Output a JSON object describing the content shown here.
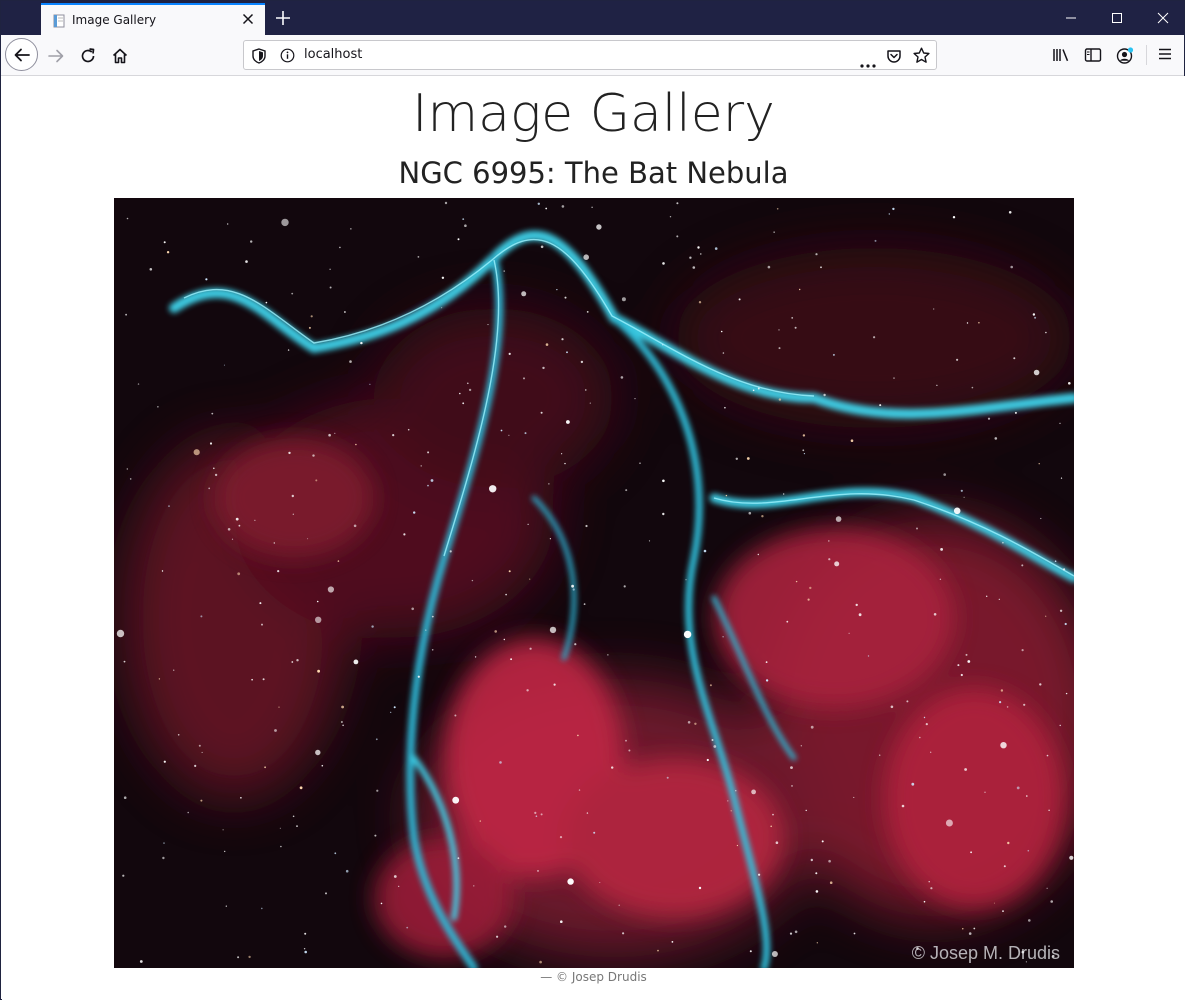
{
  "browser": {
    "tab_title": "Image Gallery",
    "url": "localhost"
  },
  "page": {
    "heading": "Image Gallery",
    "subheading": "NGC 6995: The Bat Nebula",
    "image_watermark": "© Josep M. Drudis",
    "caption": "— © Josep Drudis"
  },
  "icons": {
    "favicon": "page-icon",
    "tab_close": "close-icon",
    "new_tab": "plus-icon",
    "minimize": "minimize-icon",
    "maximize": "maximize-icon",
    "close_window": "close-icon",
    "back": "arrow-left-icon",
    "forward": "arrow-right-icon",
    "reload": "reload-icon",
    "home": "home-icon",
    "tracking_protection": "shield-icon",
    "site_info": "info-icon",
    "page_actions": "more-icon",
    "pocket": "pocket-icon",
    "bookmark": "star-icon",
    "library": "library-icon",
    "sidebar": "sidebar-icon",
    "account": "account-icon",
    "menu": "hamburger-icon"
  },
  "colors": {
    "tabstrip": "#1f2244",
    "tab_accent": "#0a84ff",
    "nebula_cyan": "#3fd6ee",
    "nebula_red": "#d8334e"
  }
}
